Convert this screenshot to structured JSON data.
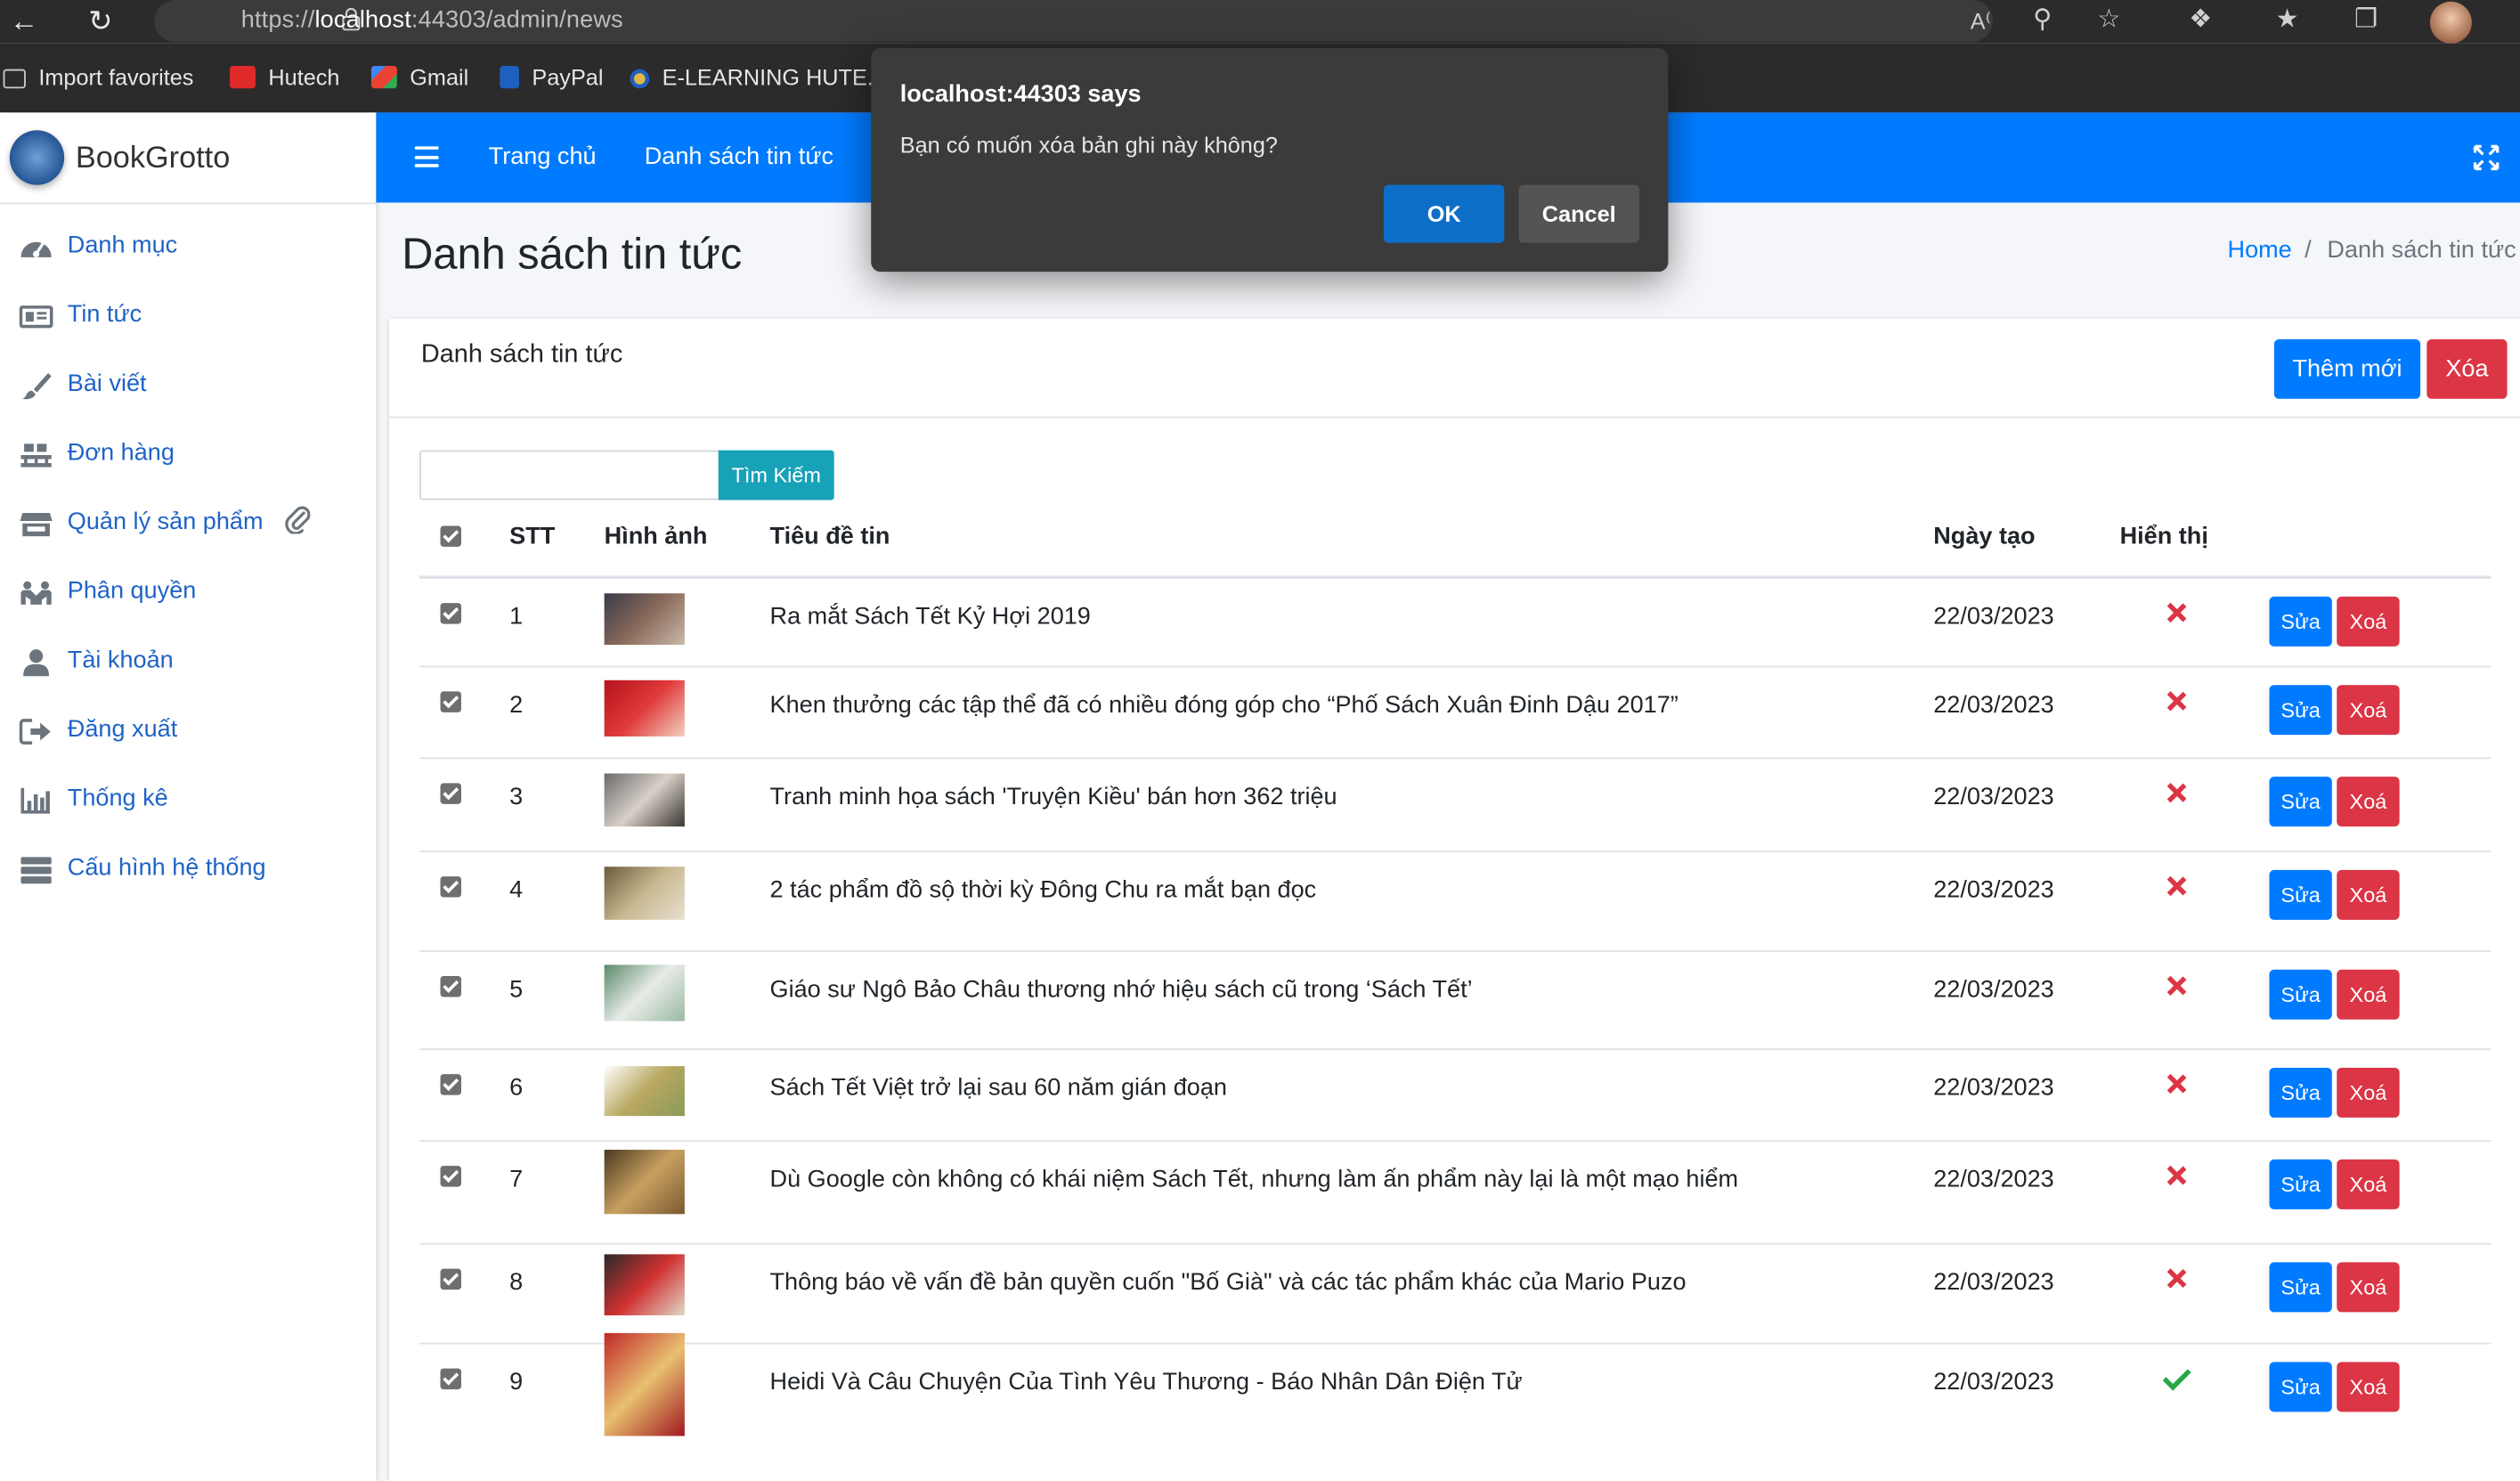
{
  "browser": {
    "url_prefix": "https://",
    "url_host": "localhost",
    "url_rest": ":44303/admin/news",
    "favorites": [
      {
        "label": "Import favorites",
        "color": "#cccccc"
      },
      {
        "label": "Hutech",
        "color": "#e02a2a"
      },
      {
        "label": "Gmail",
        "color": "#ea4335"
      },
      {
        "label": "PayPal",
        "color": "#1f5fbf"
      },
      {
        "label": "E-LEARNING HUTE...",
        "color": "#e0b84a"
      }
    ]
  },
  "dialog": {
    "title": "localhost:44303 says",
    "message": "Bạn có muốn xóa bản ghi này không?",
    "ok_label": "OK",
    "cancel_label": "Cancel"
  },
  "sidebar": {
    "brand": "BookGrotto",
    "items": [
      {
        "label": "Danh mục",
        "icon": "dashboard-icon"
      },
      {
        "label": "Tin tức",
        "icon": "newspaper-icon"
      },
      {
        "label": "Bài viết",
        "icon": "brush-icon"
      },
      {
        "label": "Đơn hàng",
        "icon": "pallet-icon"
      },
      {
        "label": "Quản lý sản phẩm",
        "icon": "store-icon"
      },
      {
        "label": "Phân quyền",
        "icon": "users-icon"
      },
      {
        "label": "Tài khoản",
        "icon": "user-icon"
      },
      {
        "label": "Đăng xuất",
        "icon": "sign-out-icon"
      },
      {
        "label": "Thống kê",
        "icon": "bar-chart-icon"
      },
      {
        "label": "Cấu hình hệ thống",
        "icon": "server-icon"
      }
    ]
  },
  "topnav": {
    "home_label": "Trang chủ",
    "news_label": "Danh sách tin tức"
  },
  "page": {
    "title": "Danh sách tin tức",
    "breadcrumb_home": "Home",
    "breadcrumb_sep": "/",
    "breadcrumb_current": "Danh sách tin tức"
  },
  "card": {
    "title": "Danh sách tin tức",
    "add_label": "Thêm mới",
    "delete_label": "Xóa",
    "search_placeholder": "",
    "search_label": "Tìm Kiếm"
  },
  "table": {
    "headers": {
      "stt": "STT",
      "image": "Hình ảnh",
      "title": "Tiêu đề tin",
      "date": "Ngày tạo",
      "visible": "Hiển thị"
    },
    "edit_label": "Sửa",
    "delete_label": "Xoá",
    "rows": [
      {
        "stt": "1",
        "title": "Ra mắt Sách Tết Kỷ Hợi 2019",
        "date": "22/03/2023",
        "visible": false,
        "thumb": [
          "#3a3a4a",
          "#8a6a5a",
          "#c9b8a8"
        ]
      },
      {
        "stt": "2",
        "title": "Khen thưởng các tập thể đã có nhiều đóng góp cho “Phố Sách Xuân Đinh Dậu 2017”",
        "date": "22/03/2023",
        "visible": false,
        "thumb": [
          "#b5121b",
          "#e03a3a",
          "#f2d0c0"
        ]
      },
      {
        "stt": "3",
        "title": "Tranh minh họa sách 'Truyện Kiều' bán hơn 362 triệu",
        "date": "22/03/2023",
        "visible": false,
        "thumb": [
          "#6a6a6a",
          "#d8d0c8",
          "#3a3530"
        ]
      },
      {
        "stt": "4",
        "title": "2 tác phẩm đồ sộ thời kỳ Đông Chu ra mắt bạn đọc",
        "date": "22/03/2023",
        "visible": false,
        "thumb": [
          "#6a5a3a",
          "#c8b890",
          "#e8e0d0"
        ]
      },
      {
        "stt": "5",
        "title": "Giáo sư Ngô Bảo Châu thương nhớ hiệu sách cũ trong ‘Sách Tết’",
        "date": "22/03/2023",
        "visible": false,
        "thumb": [
          "#5a8a6a",
          "#e8ece8",
          "#9ab8a0"
        ]
      },
      {
        "stt": "6",
        "title": "Sách Tết Việt trở lại sau 60 năm gián đoạn",
        "date": "22/03/2023",
        "visible": false,
        "thumb": [
          "#ffffff",
          "#b8a860",
          "#8a9a5a"
        ]
      },
      {
        "stt": "7",
        "title": "Dù Google còn không có khái niệm Sách Tết, nhưng làm ấn phẩm này lại là một mạo hiểm",
        "date": "22/03/2023",
        "visible": false,
        "thumb": [
          "#4a3a20",
          "#c8a060",
          "#7a5a30"
        ]
      },
      {
        "stt": "8",
        "title": "Thông báo về vấn đề bản quyền cuốn \"Bố Già\" và các tác phẩm khác của Mario Puzo",
        "date": "22/03/2023",
        "visible": false,
        "thumb": [
          "#2a2a2a",
          "#d03030",
          "#e0d8c8"
        ]
      },
      {
        "stt": "9",
        "title": "Heidi Và Câu Chuyện Của Tình Yêu Thương - Báo Nhân Dân Điện Tử",
        "date": "22/03/2023",
        "visible": true,
        "thumb": [
          "#c0282a",
          "#e8c070",
          "#a01820"
        ]
      }
    ]
  },
  "colors": {
    "primary": "#007bff",
    "danger": "#dc3545",
    "info": "#17a2b8",
    "success": "#28a745"
  }
}
